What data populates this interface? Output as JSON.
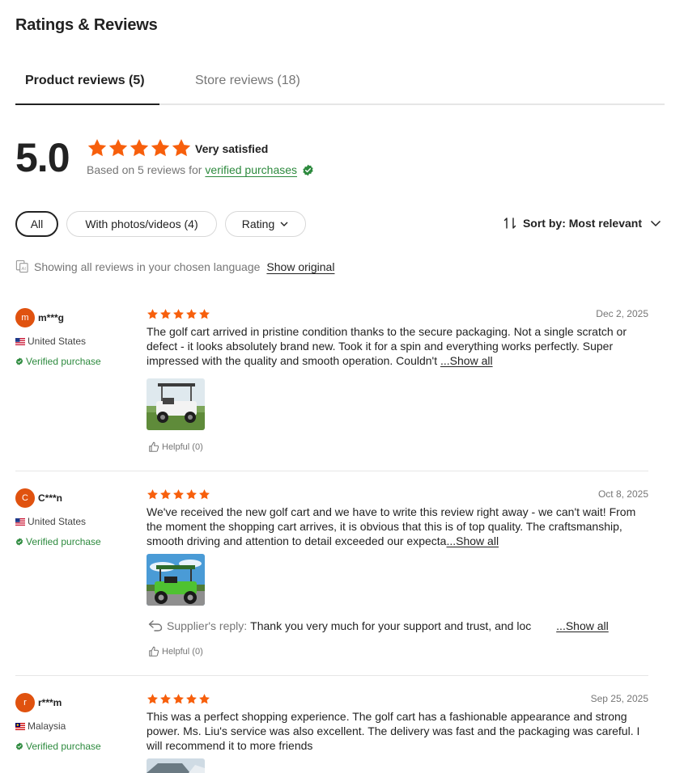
{
  "page": {
    "title": "Ratings & Reviews"
  },
  "tabs": [
    {
      "label": "Product reviews (5)"
    },
    {
      "label": "Store reviews (18)"
    }
  ],
  "summary": {
    "score": "5.0",
    "rating_stars": 5,
    "label": "Very satisfied",
    "based_on": "Based on 5 reviews for",
    "verified_link": "verified purchases"
  },
  "filters": {
    "all": "All",
    "photos": "With photos/videos (4)",
    "rating": "Rating",
    "sort": "Sort by: Most relevant"
  },
  "language_note": {
    "text": "Showing all reviews in your chosen language",
    "link": "Show original"
  },
  "colors": {
    "star": "#f75f0c",
    "verified": "#2d8a3e",
    "avatar": "#e0520f",
    "text": "#222222",
    "muted": "#767676"
  },
  "reviews": [
    {
      "avatar_letter": "m",
      "user": "m***g",
      "country": "United States",
      "verified": "Verified purchase",
      "stars": 5,
      "date": "Dec 2, 2025",
      "text": "The golf cart arrived in pristine condition thanks to the secure packaging. Not a single scratch or defect - it looks absolutely brand new. Took it for a spin and everything works perfectly. Super impressed with the quality and smooth operation. Couldn't ",
      "show_all": "...Show all",
      "helpful": "Helpful (0)"
    },
    {
      "avatar_letter": "C",
      "user": "C***n",
      "country": "United States",
      "verified": "Verified purchase",
      "stars": 5,
      "date": "Oct 8, 2025",
      "text": "We've received the new golf cart and we have to write this review right away - we can't wait! From the moment the shopping cart arrives, it is obvious that this is of top quality. The craftsmanship, smooth driving and attention to detail exceeded our expecta",
      "show_all": "...Show all",
      "reply_label": "Supplier's reply:",
      "reply_text": "Thank you very much for your support and trust, and loc",
      "reply_show_all": "...Show all",
      "helpful": "Helpful (0)"
    },
    {
      "avatar_letter": "r",
      "user": "r***m",
      "country": "Malaysia",
      "verified": "Verified purchase",
      "stars": 5,
      "date": "Sep 25, 2025",
      "text": "This was a perfect shopping experience. The golf cart has a fashionable appearance and strong power. Ms. Liu's service was also excellent. The delivery was fast and the packaging was careful. I will recommend it to more friends"
    }
  ]
}
